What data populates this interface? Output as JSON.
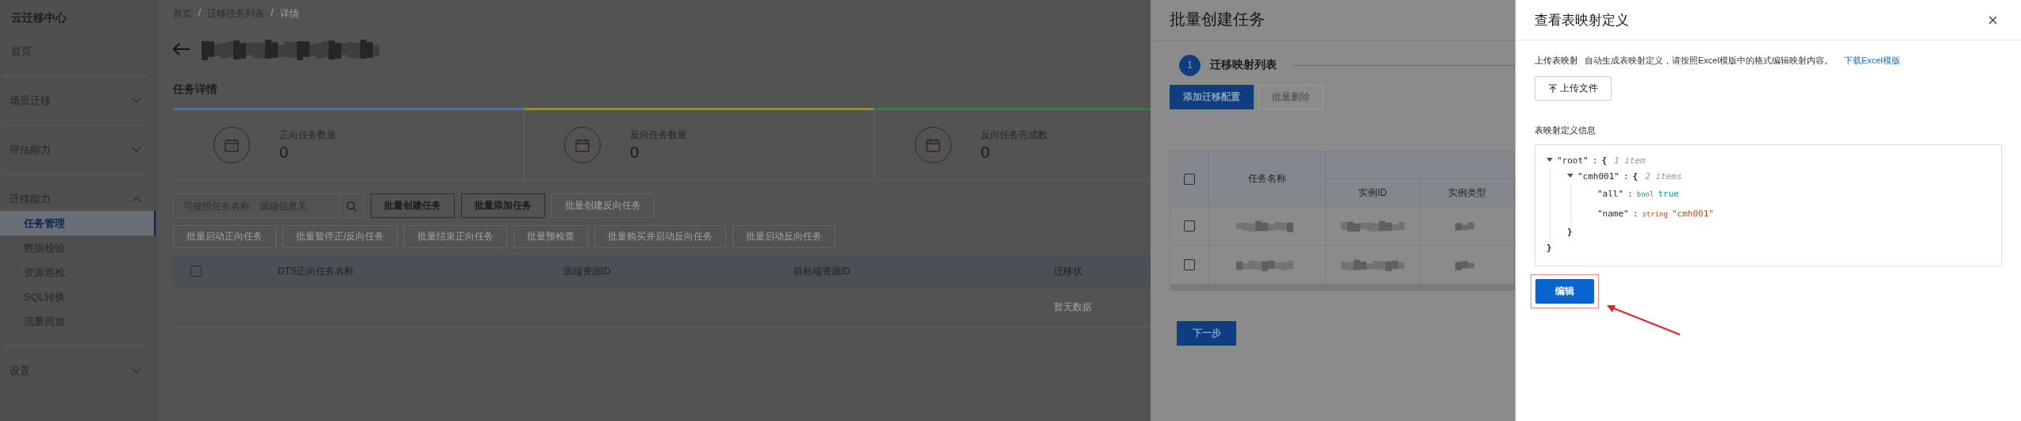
{
  "sidebar": {
    "title": "云迁移中心",
    "items": [
      {
        "kind": "link",
        "label": "首页",
        "selected": false
      },
      {
        "kind": "group",
        "label": "场景迁移",
        "expanded": false
      },
      {
        "kind": "group",
        "label": "评估能力",
        "expanded": false
      },
      {
        "kind": "group",
        "label": "迁移能力",
        "expanded": true,
        "children": [
          {
            "label": "任务管理",
            "selected": true
          },
          {
            "label": "数据校验",
            "selected": false
          },
          {
            "label": "资源巡检",
            "selected": false
          },
          {
            "label": "SQL转换",
            "selected": false
          },
          {
            "label": "流量回放",
            "selected": false
          }
        ]
      },
      {
        "kind": "group",
        "label": "设置",
        "expanded": false
      }
    ]
  },
  "breadcrumb": {
    "separator": "/",
    "items": [
      "首页",
      "迁移任务列表",
      "详情"
    ]
  },
  "page": {
    "section_title": "任务详情",
    "stats": [
      {
        "label": "正向任务数量",
        "value": "0",
        "color": "#56729a"
      },
      {
        "label": "反向任务数量",
        "value": "0",
        "color": "#938c46"
      },
      {
        "label": "反向任务完成数",
        "value": "0",
        "color": "#3d7746"
      }
    ],
    "search": {
      "placeholder": "可按照任务名称、源端信息关"
    },
    "toolbar_rows": [
      [
        {
          "label": "批量创建任务",
          "disabled": false
        },
        {
          "label": "批量添加任务",
          "disabled": false
        },
        {
          "label": "批量创建反向任务",
          "disabled": true
        }
      ],
      [
        {
          "label": "批量启动正向任务",
          "disabled": true
        },
        {
          "label": "批量暂停正/反向任务",
          "disabled": true
        },
        {
          "label": "批量结束正向任务",
          "disabled": true
        },
        {
          "label": "批量预检查",
          "disabled": true
        },
        {
          "label": "批量购买并启动反向任务",
          "disabled": true
        },
        {
          "label": "批量启动反向任务",
          "disabled": true
        }
      ]
    ],
    "table": {
      "header_checkbox": {
        "checked": false
      },
      "columns": [
        "DTS正向任务名称",
        "源端资源ID",
        "目标端资源ID",
        "迁移状"
      ],
      "empty_text": "暂无数据"
    }
  },
  "batch_drawer": {
    "title": "批量创建任务",
    "steps": [
      {
        "number": "1",
        "label": "迁移映射列表",
        "selected": true
      }
    ],
    "buttons": [
      {
        "label": "添加迁移配置",
        "kind": "primary",
        "disabled": false
      },
      {
        "label": "批量删除",
        "kind": "default",
        "disabled": true
      }
    ],
    "table": {
      "header_checkbox": {
        "checked": false
      },
      "columns": [
        {
          "label": "任务名称"
        },
        {
          "label": "实例ID"
        },
        {
          "label": "实例类型"
        }
      ],
      "rows": [
        {
          "checked": false
        },
        {
          "checked": false
        }
      ]
    },
    "next_button": "下一步"
  },
  "mapping_drawer": {
    "title": "查看表映射定义",
    "upload": {
      "label": "上传表映射",
      "description": "自动生成表映射定义，请按照Excel模版中的格式编辑映射内容。",
      "link": "下载Excel模版",
      "button": "上传文件"
    },
    "section_label": "表映射定义信息",
    "tree": {
      "key": "\"root\"",
      "colon": ":",
      "open": "{",
      "close": "}",
      "count": "1 item",
      "expanded": true,
      "children": [
        {
          "key": "\"cmh001\"",
          "colon": ":",
          "open": "{",
          "close": "}",
          "count": "2 items",
          "expanded": true,
          "children": [
            {
              "key": "\"all\"",
              "colon": ":",
              "kind": "bool",
              "type_label": "bool",
              "value": "true"
            },
            {
              "key": "\"name\"",
              "colon": ":",
              "kind": "string",
              "type_label": "string",
              "value": "\"cmh001\""
            }
          ]
        }
      ]
    },
    "edit_button": "编辑"
  }
}
